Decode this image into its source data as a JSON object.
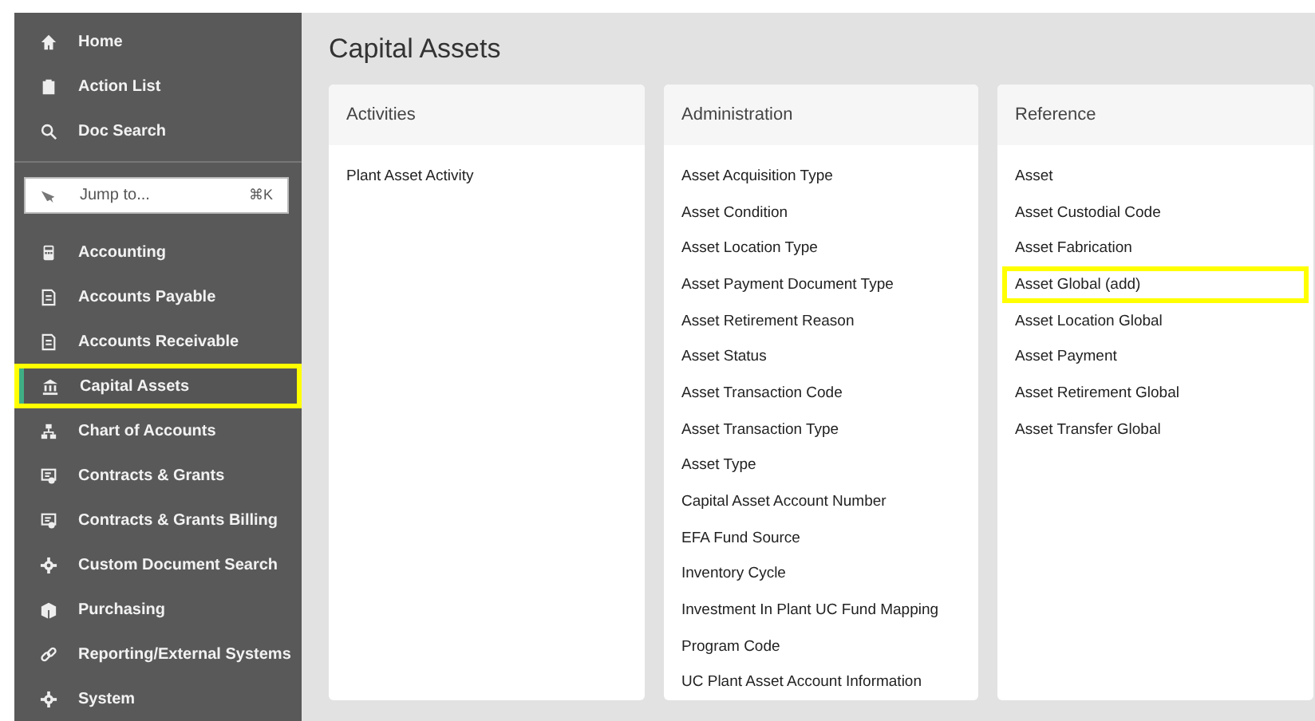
{
  "sidebar": {
    "top_items": [
      {
        "label": "Home"
      },
      {
        "label": "Action List"
      },
      {
        "label": "Doc Search"
      }
    ],
    "jump": {
      "placeholder": "Jump to...",
      "shortcut": "⌘K"
    },
    "items": [
      {
        "label": "Accounting",
        "selected": false,
        "highlighted": false
      },
      {
        "label": "Accounts Payable",
        "selected": false,
        "highlighted": false
      },
      {
        "label": "Accounts Receivable",
        "selected": false,
        "highlighted": false
      },
      {
        "label": "Capital Assets",
        "selected": true,
        "highlighted": true
      },
      {
        "label": "Chart of Accounts",
        "selected": false,
        "highlighted": false
      },
      {
        "label": "Contracts & Grants",
        "selected": false,
        "highlighted": false
      },
      {
        "label": "Contracts & Grants Billing",
        "selected": false,
        "highlighted": false
      },
      {
        "label": "Custom Document Search",
        "selected": false,
        "highlighted": false
      },
      {
        "label": "Purchasing",
        "selected": false,
        "highlighted": false
      },
      {
        "label": "Reporting/External Systems",
        "selected": false,
        "highlighted": false
      },
      {
        "label": "System",
        "selected": false,
        "highlighted": false
      }
    ]
  },
  "page_title": "Capital Assets",
  "cards": [
    {
      "title": "Activities",
      "links": [
        {
          "label": "Plant Asset Activity",
          "highlighted": false
        }
      ]
    },
    {
      "title": "Administration",
      "links": [
        {
          "label": "Asset Acquisition Type",
          "highlighted": false
        },
        {
          "label": "Asset Condition",
          "highlighted": false
        },
        {
          "label": "Asset Location Type",
          "highlighted": false
        },
        {
          "label": "Asset Payment Document Type",
          "highlighted": false
        },
        {
          "label": "Asset Retirement Reason",
          "highlighted": false
        },
        {
          "label": "Asset Status",
          "highlighted": false
        },
        {
          "label": "Asset Transaction Code",
          "highlighted": false
        },
        {
          "label": "Asset Transaction Type",
          "highlighted": false
        },
        {
          "label": "Asset Type",
          "highlighted": false
        },
        {
          "label": "Capital Asset Account Number",
          "highlighted": false
        },
        {
          "label": "EFA Fund Source",
          "highlighted": false
        },
        {
          "label": "Inventory Cycle",
          "highlighted": false
        },
        {
          "label": "Investment In Plant UC Fund Mapping",
          "highlighted": false
        },
        {
          "label": "Program Code",
          "highlighted": false
        },
        {
          "label": "UC Plant Asset Account Information",
          "highlighted": false
        }
      ]
    },
    {
      "title": "Reference",
      "links": [
        {
          "label": "Asset",
          "highlighted": false
        },
        {
          "label": "Asset Custodial Code",
          "highlighted": false
        },
        {
          "label": "Asset Fabrication",
          "highlighted": false
        },
        {
          "label": "Asset Global (add)",
          "highlighted": true
        },
        {
          "label": "Asset Location Global",
          "highlighted": false
        },
        {
          "label": "Asset Payment",
          "highlighted": false
        },
        {
          "label": "Asset Retirement Global",
          "highlighted": false
        },
        {
          "label": "Asset Transfer Global",
          "highlighted": false
        }
      ]
    }
  ]
}
